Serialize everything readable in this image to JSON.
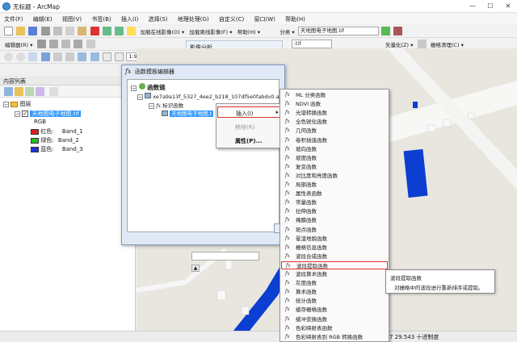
{
  "window": {
    "title": "无标题 - ArcMap",
    "min": "—",
    "max": "☐",
    "close": "✕"
  },
  "menubar": [
    "文件(F)",
    "编辑(E)",
    "视图(V)",
    "书签(B)",
    "插入(I)",
    "选择(S)",
    "地理处理(G)",
    "自定义(C)",
    "窗口(W)",
    "帮助(H)"
  ],
  "toolbar1": {
    "basemap_label": "加载在线影像(O) ▾",
    "offline_label": "加载离线影像(F) ▾",
    "help_label": "帮助(H) ▾",
    "class_label": "分类 ▾",
    "layer_combo": "天地图电子地图.tif"
  },
  "toolbar2": {
    "editor_label": "编辑器(R) ▾",
    "tif_combo": ".tif",
    "vector_label": "矢量化(Z) ▾",
    "raster_clean_label": "栅格清理(C) ▾"
  },
  "toolbar3": {
    "scale": "1:9,132"
  },
  "image_analysis": {
    "title": "影像分析"
  },
  "toc": {
    "title": "内容列表",
    "layers_label": "图层",
    "layer_name": "天地图电子地图.tif",
    "rgb": "RGB",
    "bands": [
      {
        "label": "红色:",
        "band": "Band_1",
        "color": "#e02020"
      },
      {
        "label": "绿色:",
        "band": "Band_2",
        "color": "#20c020"
      },
      {
        "label": "蓝色:",
        "band": "Band_3",
        "color": "#2030e0"
      }
    ]
  },
  "dialog": {
    "title": "函数模板编辑器",
    "root": "函数链",
    "child": "xe7a9a13f_5327_4ee2_b218_107df5e0fabdv0.afr",
    "identity": "标识函数",
    "selected": "天地图电子地图.t"
  },
  "context_menu": [
    {
      "label": "插入(I)",
      "arrow": "▸",
      "highlighted": true
    },
    {
      "label": "移除(R)",
      "disabled": true
    },
    {
      "label": "属性(P)...",
      "bold": true
    }
  ],
  "functions": [
    "ML 分类函数",
    "NDVI 函数",
    "光谱转换函数",
    "全色锐化函数",
    "几何函数",
    "卷积插值函数",
    "坡向函数",
    "坡度函数",
    "复变函数",
    "对比度和亮度函数",
    "局部函数",
    "属性表函数",
    "常量函数",
    "拉伸函数",
    "掩膜函数",
    "斑点函数",
    "晕渲地貌函数",
    "栅格信息函数",
    "波段合成函数",
    "波段提取函数",
    "波段算术函数",
    "灰度函数",
    "算术函数",
    "统计函数",
    "缓存栅格函数",
    "缓冲变换函数",
    "色彩映射表函数",
    "色彩映射表到 RGB 转换函数"
  ],
  "highlighted_function": "波段提取函数",
  "tooltip": {
    "title": "波段提取函数",
    "desc": "对栅格中的波段进行重新排序或提取。"
  },
  "status": {
    "coords": "7  29.543 十进制度"
  },
  "colors": {
    "accent": "#3399ff",
    "water": "#0b3ed1",
    "highlight_border": "#e03030"
  }
}
